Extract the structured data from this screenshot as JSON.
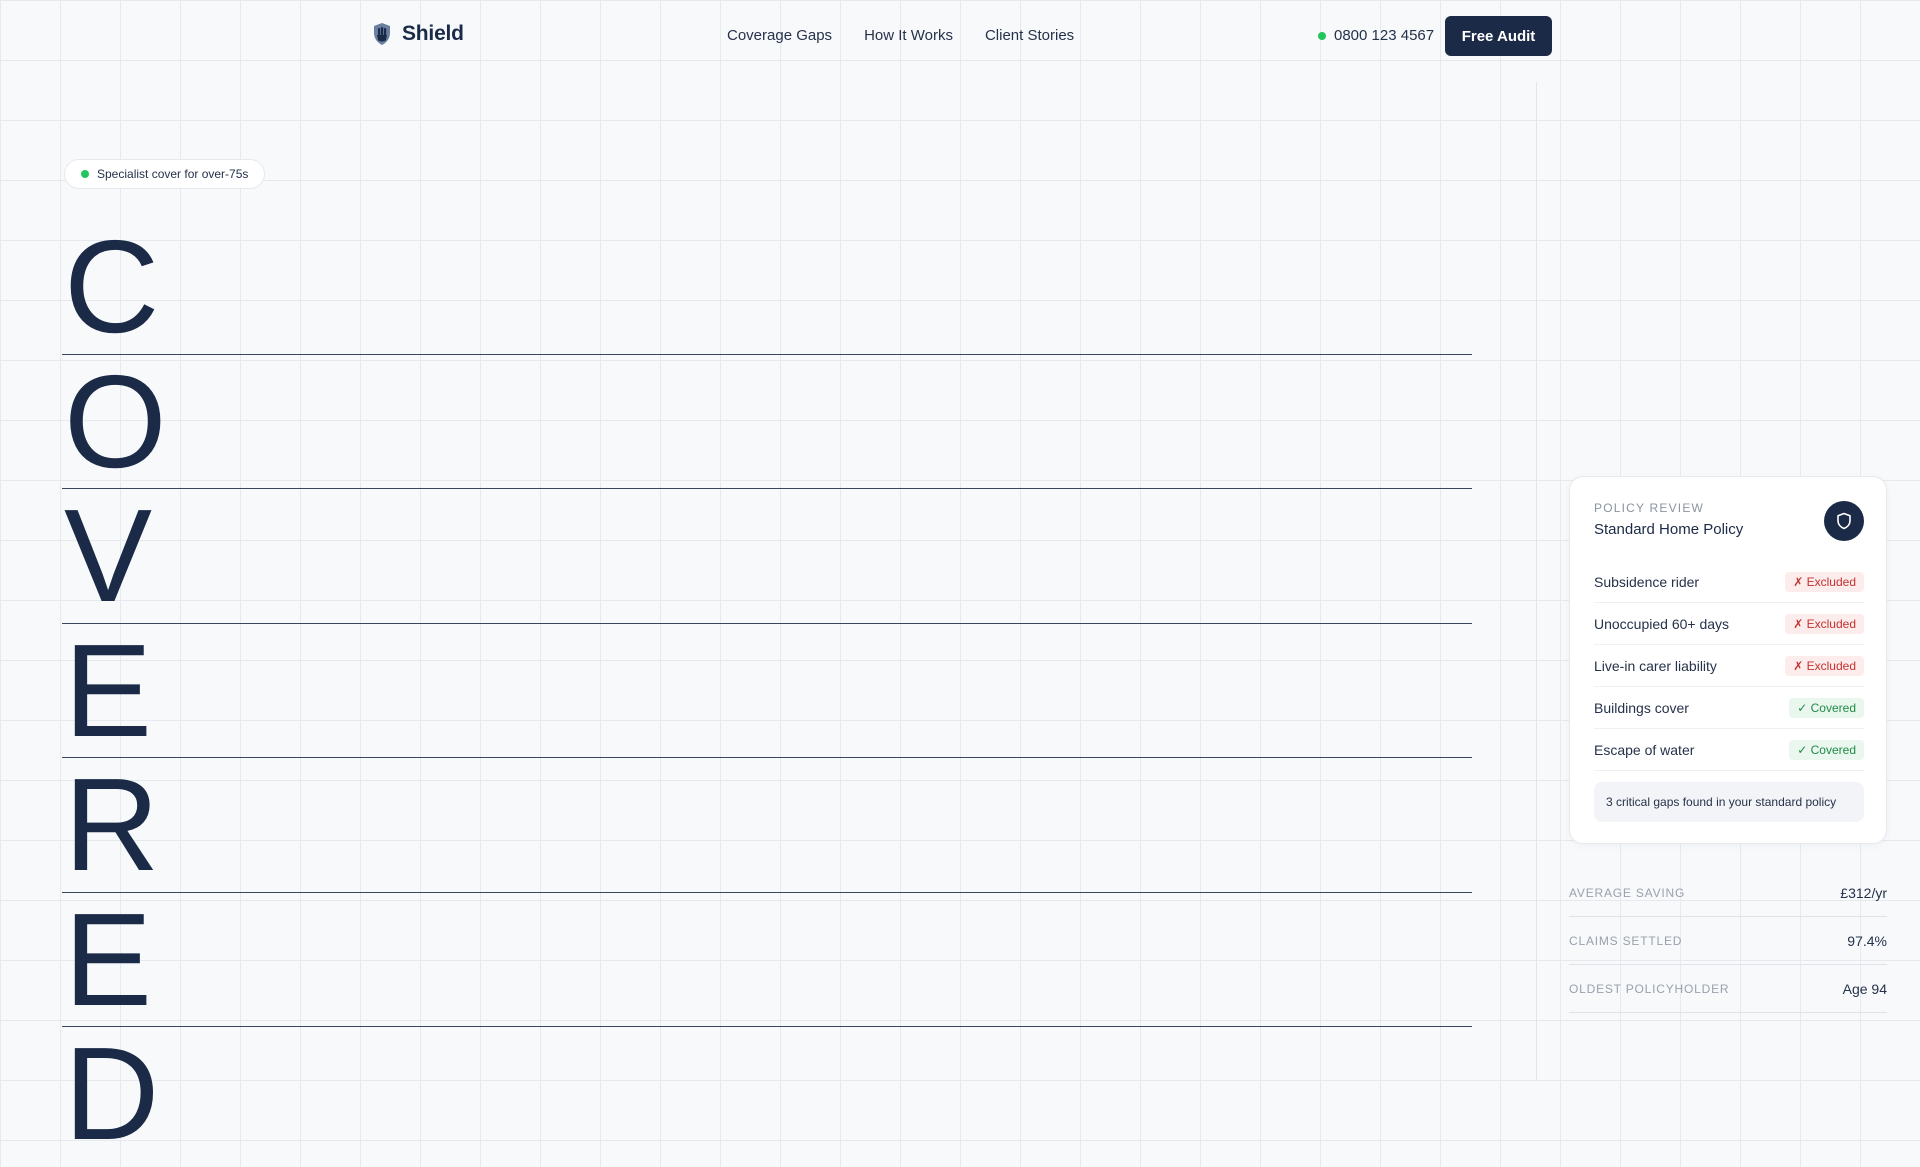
{
  "brand": {
    "name": "Shield"
  },
  "nav": [
    "Coverage Gaps",
    "How It Works",
    "Client Stories"
  ],
  "contact": {
    "phone": "0800 123 4567"
  },
  "cta": {
    "label": "Free Audit"
  },
  "hero": {
    "badge": "Specialist cover for over-75s",
    "letters": [
      "C",
      "O",
      "V",
      "E",
      "R",
      "E",
      "D"
    ]
  },
  "policy_card": {
    "eyebrow": "POLICY REVIEW",
    "title": "Standard Home Policy",
    "rows": [
      {
        "label": "Subsidence rider",
        "status": "✗ Excluded",
        "state": "excluded"
      },
      {
        "label": "Unoccupied 60+ days",
        "status": "✗ Excluded",
        "state": "excluded"
      },
      {
        "label": "Live-in carer liability",
        "status": "✗ Excluded",
        "state": "excluded"
      },
      {
        "label": "Buildings cover",
        "status": "✓ Covered",
        "state": "covered"
      },
      {
        "label": "Escape of water",
        "status": "✓ Covered",
        "state": "covered"
      }
    ],
    "note": "3 critical gaps found in your standard policy"
  },
  "stats": [
    {
      "label": "AVERAGE SAVING",
      "value": "£312/yr"
    },
    {
      "label": "CLAIMS SETTLED",
      "value": "97.4%"
    },
    {
      "label": "OLDEST POLICYHOLDER",
      "value": "Age 94"
    }
  ],
  "colors": {
    "navy": "#1b2a47",
    "status_green": "#22c55e",
    "excluded_red": "#c53030",
    "covered_green": "#1f8a46"
  },
  "icons": [
    "hand-shield-logo-icon",
    "online-status-dot-icon",
    "shield-icon",
    "badge-dot-icon"
  ]
}
